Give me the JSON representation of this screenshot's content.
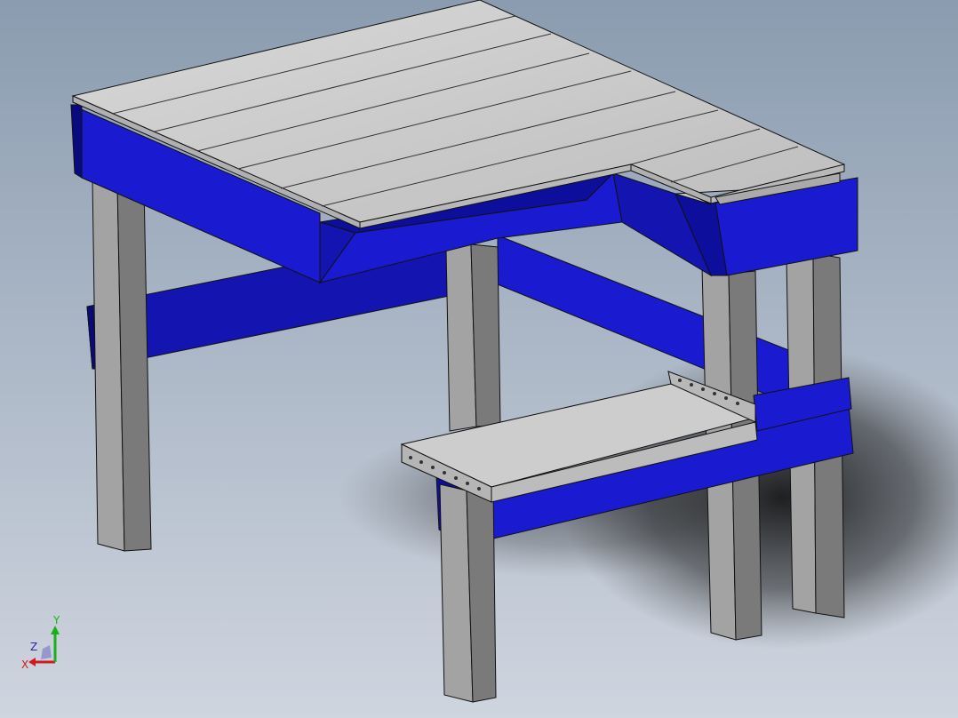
{
  "viewport": {
    "background_top": "#8b9cb0",
    "background_bottom": "#cfd5df",
    "model": {
      "frame_color": "#1a1ad1",
      "frame_dark": "#0a0a86",
      "frame_mid": "#1414a6",
      "plank_color": "#c8c8c8",
      "plank_light": "#d6d6d6",
      "leg_color": "#9c9c9c",
      "leg_dark": "#6f6f6f",
      "edge_color": "#111111"
    }
  },
  "triad": {
    "x_label": "X",
    "y_label": "Y",
    "z_label": "Z",
    "x_color": "#d21a1a",
    "y_color": "#1ab01a",
    "z_color": "#2a2aa0",
    "icon": "axis-triad-icon"
  }
}
